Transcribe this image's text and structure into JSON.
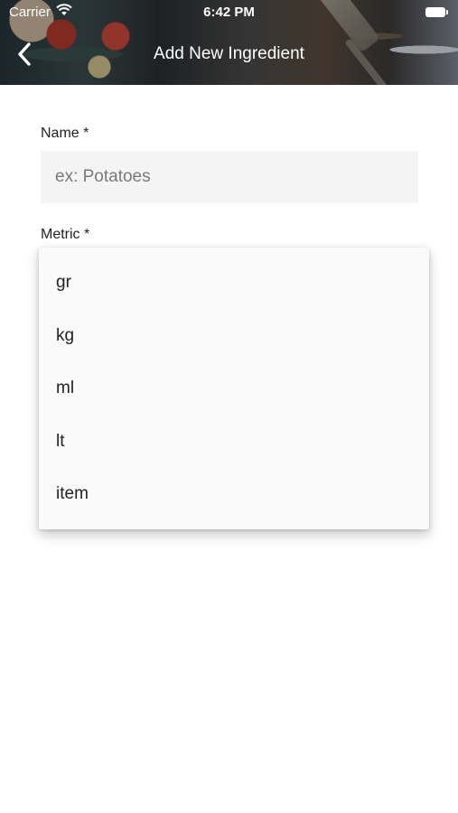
{
  "status_bar": {
    "carrier": "Carrier",
    "time": "6:42 PM"
  },
  "nav": {
    "title": "Add New Ingredient",
    "back_icon": "chevron-left-icon"
  },
  "form": {
    "name_label": "Name *",
    "name_placeholder": "ex: Potatoes",
    "name_value": "",
    "metric_label": "Metric *"
  },
  "metric_menu": {
    "options": [
      "gr",
      "kg",
      "ml",
      "lt",
      "item"
    ]
  },
  "colors": {
    "text": "#222222",
    "input_bg": "#f4f4f4",
    "menu_bg": "#fafafa",
    "header_text": "#ffffff"
  }
}
